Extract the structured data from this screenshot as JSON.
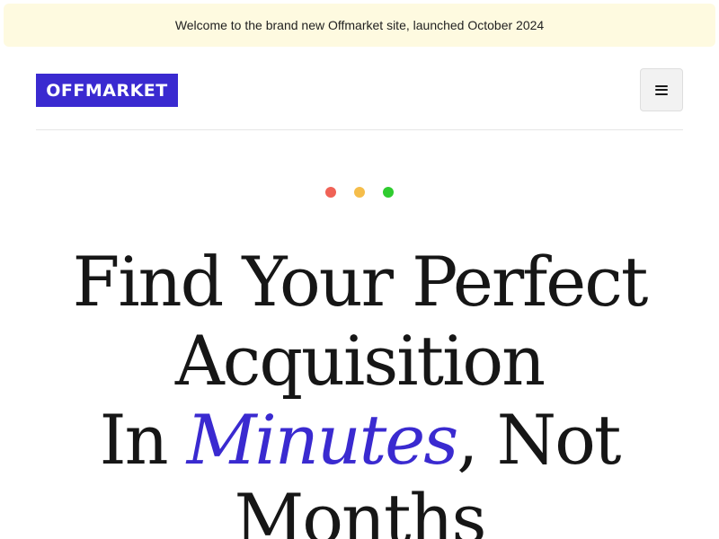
{
  "announcement": {
    "text": "Welcome to the brand new Offmarket site, launched October 2024"
  },
  "header": {
    "logo_text": "OFFMARKET",
    "menu_icon": "hamburger-menu-icon"
  },
  "decor_dots": [
    {
      "name": "red-dot",
      "color": "#f06256"
    },
    {
      "name": "yellow-dot",
      "color": "#f5bd4a"
    },
    {
      "name": "green-dot",
      "color": "#2fcc2f"
    }
  ],
  "hero": {
    "line1": "Find Your Perfect",
    "line2": "Acquisition",
    "line3_prefix": "In ",
    "line3_highlight": "Minutes",
    "line3_suffix": ", Not",
    "line4": "Months"
  },
  "colors": {
    "brand": "#3a2ad0",
    "banner_bg": "#fefae0"
  }
}
